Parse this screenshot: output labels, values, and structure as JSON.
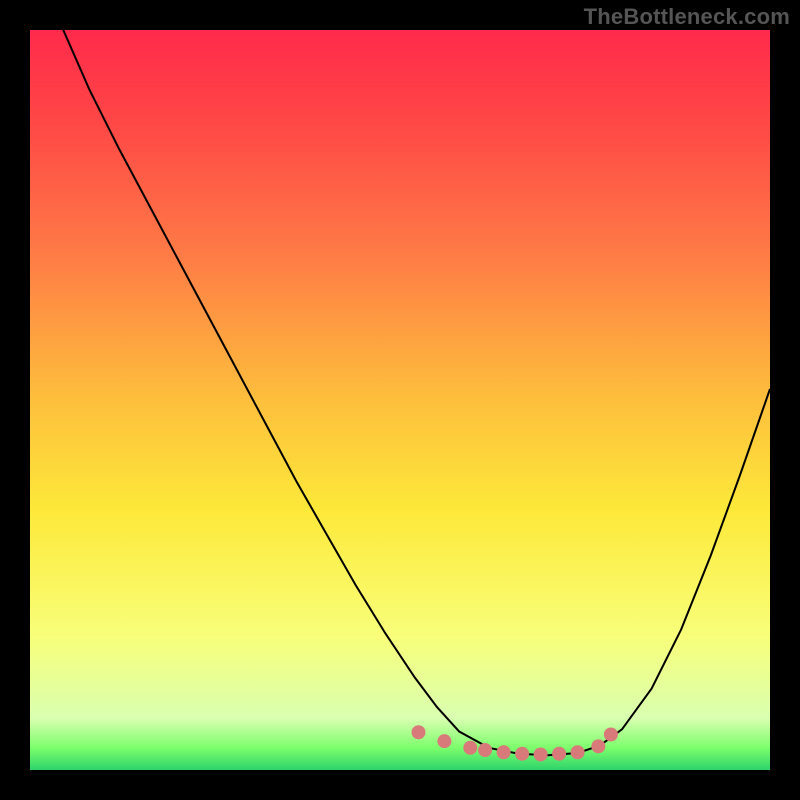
{
  "attribution": "TheBottleneck.com",
  "chart_data": {
    "type": "line",
    "title": "",
    "xlabel": "",
    "ylabel": "",
    "xlim": [
      0,
      100
    ],
    "ylim": [
      0,
      100
    ],
    "background_gradient": {
      "stops": [
        {
          "offset": 0.0,
          "color": "#ff2a4b"
        },
        {
          "offset": 0.12,
          "color": "#ff4646"
        },
        {
          "offset": 0.3,
          "color": "#fe7a46"
        },
        {
          "offset": 0.5,
          "color": "#fdbf3c"
        },
        {
          "offset": 0.65,
          "color": "#fde93a"
        },
        {
          "offset": 0.82,
          "color": "#f8ff7a"
        },
        {
          "offset": 0.93,
          "color": "#d9ffb0"
        },
        {
          "offset": 0.97,
          "color": "#7cfe6c"
        },
        {
          "offset": 1.0,
          "color": "#2dd36b"
        }
      ]
    },
    "series": [
      {
        "name": "curve",
        "x": [
          4.5,
          8,
          12,
          16,
          20,
          24,
          28,
          32,
          36,
          40,
          44,
          48,
          52,
          55,
          58,
          62,
          66,
          70,
          74,
          77,
          80,
          84,
          88,
          92,
          96,
          100
        ],
        "y": [
          100,
          92,
          84,
          76.5,
          69,
          61.5,
          54,
          46.5,
          39,
          32,
          25,
          18.5,
          12.5,
          8.5,
          5.2,
          3.0,
          2.2,
          2.0,
          2.3,
          3.3,
          5.5,
          11,
          19,
          29,
          40,
          51.5
        ]
      }
    ],
    "plateau_markers": {
      "color": "#d97a7a",
      "radius_px": 7,
      "points_x": [
        52.5,
        56,
        59.5,
        61.5,
        64,
        66.5,
        69,
        71.5,
        74,
        76.8,
        78.5
      ],
      "points_y": [
        5.1,
        3.9,
        3.0,
        2.7,
        2.4,
        2.2,
        2.1,
        2.2,
        2.4,
        3.2,
        4.8
      ]
    }
  }
}
